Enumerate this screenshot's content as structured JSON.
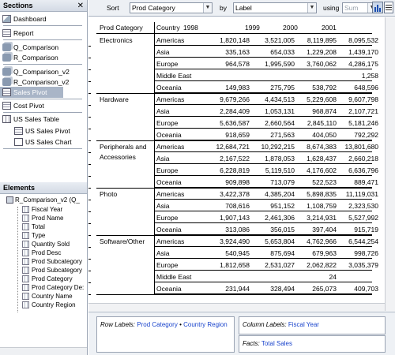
{
  "sections": {
    "title": "Sections",
    "close": "✕",
    "items": [
      {
        "label": "Dashboard",
        "icon": "dashboard-icon"
      },
      {
        "label": "Report",
        "icon": "report-icon"
      },
      {
        "label": "Q_Comparison",
        "icon": "query-icon"
      },
      {
        "label": "R_Comparison",
        "icon": "query-icon"
      },
      {
        "label": "Q_Comparison_v2",
        "icon": "query-icon"
      },
      {
        "label": "R_Comparison_v2",
        "icon": "query-icon"
      },
      {
        "label": "Sales Pivot",
        "icon": "pivot-icon",
        "selected": true
      },
      {
        "label": "Cost Pivot",
        "icon": "pivot-icon"
      },
      {
        "label": "US Sales Table",
        "icon": "table-icon"
      },
      {
        "label": "US Sales Pivot",
        "icon": "pivot-icon"
      },
      {
        "label": "US Sales Chart",
        "icon": "chart-icon"
      }
    ]
  },
  "elements": {
    "title": "Elements",
    "root": "R_Comparison_v2 (Q_",
    "fields": [
      "Fiscal Year",
      "Prod Name",
      "Total",
      "Type",
      "Quantity Sold",
      "Prod Desc",
      "Prod Subcategory",
      "Prod Subcategory",
      "Prod Category",
      "Prod Category De:",
      "Country Name",
      "Country Region"
    ]
  },
  "toolbar": {
    "sort_label": "Sort",
    "sort_value": "Prod Category",
    "by_label": "by",
    "by_value": "Label",
    "using_label": "using",
    "using_value": "Sum",
    "arrow": "▼"
  },
  "pivot": {
    "headers": {
      "category": "Prod Category",
      "country": "Country",
      "years": [
        "1998",
        "1999",
        "2000",
        "2001"
      ]
    },
    "groups": [
      {
        "category": "Electronics",
        "rows": [
          {
            "country": "Americas",
            "values": [
              "1,820,148",
              "3,521,005",
              "8,119,895",
              "8,095,532"
            ]
          },
          {
            "country": "Asia",
            "values": [
              "335,163",
              "654,033",
              "1,229,208",
              "1,439,170"
            ]
          },
          {
            "country": "Europe",
            "values": [
              "964,578",
              "1,995,590",
              "3,760,062",
              "4,286,175"
            ]
          },
          {
            "country": "Middle East",
            "values": [
              "",
              "",
              "",
              "1,258"
            ]
          },
          {
            "country": "Oceania",
            "values": [
              "149,983",
              "275,795",
              "538,792",
              "648,596"
            ]
          }
        ]
      },
      {
        "category": "Hardware",
        "rows": [
          {
            "country": "Americas",
            "values": [
              "9,679,266",
              "4,434,513",
              "5,229,608",
              "9,607,798"
            ]
          },
          {
            "country": "Asia",
            "values": [
              "2,284,409",
              "1,053,131",
              "968,874",
              "2,107,721"
            ]
          },
          {
            "country": "Europe",
            "values": [
              "5,636,587",
              "2,660,564",
              "2,845,110",
              "5,181,246"
            ]
          },
          {
            "country": "Oceania",
            "values": [
              "918,659",
              "271,563",
              "404,050",
              "792,292"
            ]
          }
        ]
      },
      {
        "category": "Peripherals and Accessories",
        "rows": [
          {
            "country": "Americas",
            "values": [
              "12,684,721",
              "10,292,215",
              "8,674,383",
              "13,801,680"
            ]
          },
          {
            "country": "Asia",
            "values": [
              "2,167,522",
              "1,878,053",
              "1,628,437",
              "2,660,218"
            ]
          },
          {
            "country": "Europe",
            "values": [
              "6,228,819",
              "5,119,510",
              "4,176,602",
              "6,636,796"
            ]
          },
          {
            "country": "Oceania",
            "values": [
              "909,898",
              "713,079",
              "522,523",
              "889,471"
            ]
          }
        ]
      },
      {
        "category": "Photo",
        "rows": [
          {
            "country": "Americas",
            "values": [
              "3,422,378",
              "4,385,204",
              "5,898,835",
              "11,119,031"
            ]
          },
          {
            "country": "Asia",
            "values": [
              "708,616",
              "951,152",
              "1,108,759",
              "2,323,530"
            ]
          },
          {
            "country": "Europe",
            "values": [
              "1,907,143",
              "2,461,306",
              "3,214,931",
              "5,527,992"
            ]
          },
          {
            "country": "Oceania",
            "values": [
              "313,086",
              "356,015",
              "397,404",
              "915,719"
            ]
          }
        ]
      },
      {
        "category": "Software/Other",
        "rows": [
          {
            "country": "Americas",
            "values": [
              "3,924,490",
              "5,653,804",
              "4,762,966",
              "6,544,254"
            ]
          },
          {
            "country": "Asia",
            "values": [
              "540,945",
              "875,694",
              "679,963",
              "998,726"
            ]
          },
          {
            "country": "Europe",
            "values": [
              "1,812,658",
              "2,531,027",
              "2,062,822",
              "3,035,379"
            ]
          },
          {
            "country": "Middle East",
            "values": [
              "",
              "",
              "24",
              ""
            ]
          },
          {
            "country": "Oceania",
            "values": [
              "231,944",
              "328,494",
              "265,073",
              "409,703"
            ]
          }
        ]
      }
    ]
  },
  "bottom": {
    "row_labels_label": "Row Labels:",
    "row_labels_value1": "Prod Category",
    "row_labels_sep": " • ",
    "row_labels_value2": "Country Region",
    "column_labels_label": "Column Labels:",
    "column_labels_value": "Fiscal Year",
    "facts_label": "Facts:",
    "facts_value": "Total Sales"
  }
}
